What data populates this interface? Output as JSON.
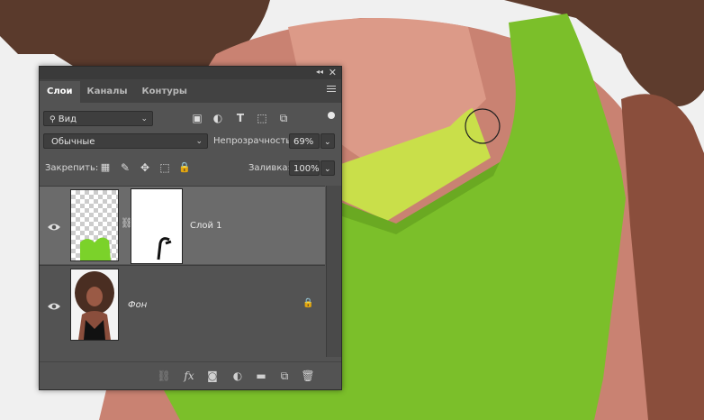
{
  "panel": {
    "tabs": [
      {
        "label": "Слои",
        "active": true
      },
      {
        "label": "Каналы",
        "active": false
      },
      {
        "label": "Контуры",
        "active": false
      }
    ],
    "filter": {
      "label": "Вид",
      "icon": "search-icon"
    },
    "blend_mode": "Обычные",
    "opacity": {
      "label": "Непрозрачность:",
      "value": "69%"
    },
    "lock_label": "Закрепить:",
    "fill": {
      "label": "Заливка:",
      "value": "100%"
    },
    "layers": [
      {
        "name": "Слой 1",
        "selected": true
      },
      {
        "name": "Фон",
        "selected": false,
        "locked": true
      }
    ]
  },
  "colors": {
    "panel_bg": "#535353",
    "selected_layer": "#6b6b6b",
    "overlay_green": "#7bbf2a"
  }
}
